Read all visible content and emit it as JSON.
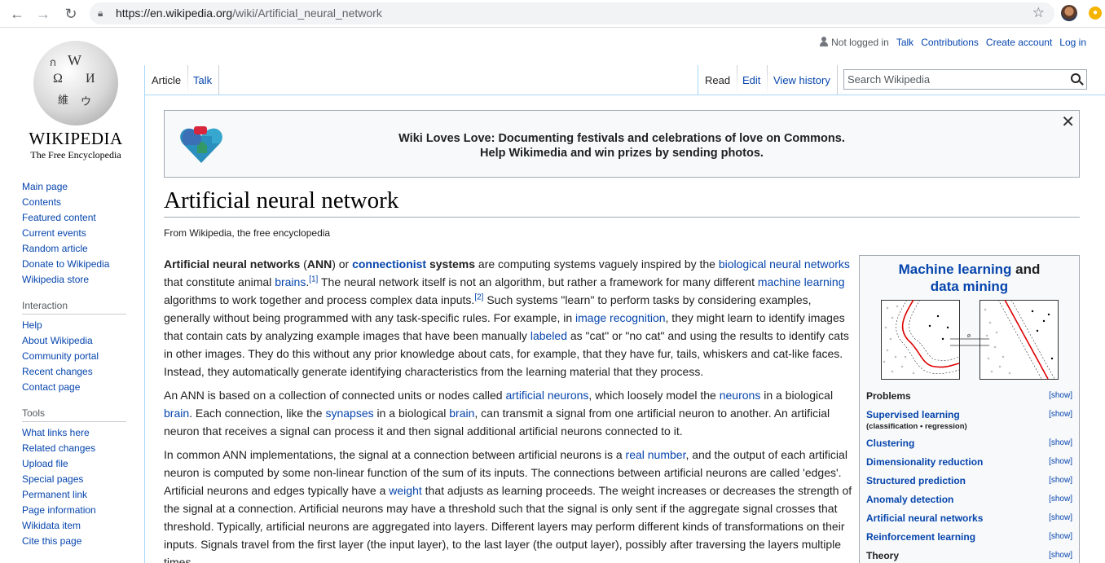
{
  "browser": {
    "url_host": "https://en.wikipedia.org",
    "url_path": "/wiki/Artificial_neural_network",
    "back_icon": "arrow-left-icon",
    "forward_icon": "arrow-right-icon",
    "reload_icon": "reload-icon"
  },
  "logo": {
    "wordmark": "WIKIPEDIA",
    "tagline": "The Free Encyclopedia",
    "glyphs": [
      "W",
      "Ω",
      "И",
      "維",
      "ウ",
      "ก"
    ]
  },
  "sidebar": {
    "navigation": [
      "Main page",
      "Contents",
      "Featured content",
      "Current events",
      "Random article",
      "Donate to Wikipedia",
      "Wikipedia store"
    ],
    "interaction_heading": "Interaction",
    "interaction": [
      "Help",
      "About Wikipedia",
      "Community portal",
      "Recent changes",
      "Contact page"
    ],
    "tools_heading": "Tools",
    "tools": [
      "What links here",
      "Related changes",
      "Upload file",
      "Special pages",
      "Permanent link",
      "Page information",
      "Wikidata item",
      "Cite this page"
    ]
  },
  "personal": {
    "not_logged_in": "Not logged in",
    "talk": "Talk",
    "contributions": "Contributions",
    "create_account": "Create account",
    "log_in": "Log in"
  },
  "tabs": {
    "article": "Article",
    "talk": "Talk",
    "read": "Read",
    "edit": "Edit",
    "view_history": "View history"
  },
  "search": {
    "placeholder": "Search Wikipedia"
  },
  "banner": {
    "line1": "Wiki Loves Love: Documenting festivals and celebrations of love on Commons.",
    "line2": "Help Wikimedia and win prizes by sending photos.",
    "close": "✕"
  },
  "article": {
    "title": "Artificial neural network",
    "from": "From Wikipedia, the free encyclopedia",
    "p1": {
      "t1": "Artificial neural networks",
      "t2": " (",
      "t3": "ANN",
      "t4": ") or ",
      "l1": "connectionist",
      "t5": " systems",
      "t6": " are computing systems vaguely inspired by the ",
      "l2": "biological neural networks",
      "t7": " that constitute animal ",
      "l3": "brains",
      "r1": "[1]",
      "t8": " The neural network itself is not an algorithm, but rather a framework for many different ",
      "l4": "machine learning",
      "t9": " algorithms to work together and process complex data inputs.",
      "r2": "[2]",
      "t10": " Such systems \"learn\" to perform tasks by considering examples, generally without being programmed with any task-specific rules. For example, in ",
      "l5": "image recognition",
      "t11": ", they might learn to identify images that contain cats by analyzing example images that have been manually ",
      "l6": "labeled",
      "t12": " as \"cat\" or \"no cat\" and using the results to identify cats in other images. They do this without any prior knowledge about cats, for example, that they have fur, tails, whiskers and cat-like faces. Instead, they automatically generate identifying characteristics from the learning material that they process."
    },
    "p2": {
      "t1": "An ANN is based on a collection of connected units or nodes called ",
      "l1": "artificial neurons",
      "t2": ", which loosely model the ",
      "l2": "neurons",
      "t3": " in a biological ",
      "l3": "brain",
      "t4": ". Each connection, like the ",
      "l4": "synapses",
      "t5": " in a biological ",
      "l5": "brain",
      "t6": ", can transmit a signal from one artificial neuron to another. An artificial neuron that receives a signal can process it and then signal additional artificial neurons connected to it."
    },
    "p3": {
      "t1": "In common ANN implementations, the signal at a connection between artificial neurons is a ",
      "l1": "real number",
      "t2": ", and the output of each artificial neuron is computed by some non-linear function of the sum of its inputs. The connections between artificial neurons are called 'edges'. Artificial neurons and edges typically have a ",
      "l2": "weight",
      "t3": " that adjusts as learning proceeds. The weight increases or decreases the strength of the signal at a connection. Artificial neurons may have a threshold such that the signal is only sent if the aggregate signal crosses that threshold. Typically, artificial neurons are aggregated into layers. Different layers may perform different kinds of transformations on their inputs. Signals travel from the first layer (the input layer), to the last layer (the output layer), possibly after traversing the layers multiple times."
    }
  },
  "infobox": {
    "title_link1": "Machine learning",
    "title_and": " and",
    "title_link2": "data mining",
    "show": "[show]",
    "rows": [
      {
        "label": "Problems",
        "link": false
      },
      {
        "label": "Supervised learning",
        "link": true,
        "sub": "(classification • regression)"
      },
      {
        "label": "Clustering",
        "link": true
      },
      {
        "label": "Dimensionality reduction",
        "link": true
      },
      {
        "label": "Structured prediction",
        "link": true
      },
      {
        "label": "Anomaly detection",
        "link": true
      },
      {
        "label": "Artificial neural networks",
        "link": true
      },
      {
        "label": "Reinforcement learning",
        "link": true
      },
      {
        "label": "Theory",
        "link": false
      }
    ]
  }
}
